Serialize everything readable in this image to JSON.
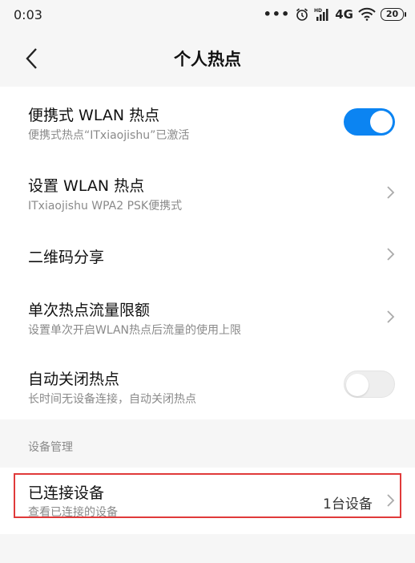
{
  "status_bar": {
    "time": "0:03",
    "more": "•••",
    "network": "4G",
    "battery": "20",
    "icons": [
      "alarm-icon",
      "hd-signal-icon",
      "wifi-icon",
      "battery-icon"
    ]
  },
  "header": {
    "title": "个人热点",
    "back_icon": "chevron-left-icon"
  },
  "settings": [
    {
      "title": "便携式 WLAN 热点",
      "subtitle": "便携式热点“ITxiaojishu”已激活",
      "control": "toggle",
      "on": true
    },
    {
      "title": "设置 WLAN 热点",
      "subtitle": "ITxiaojishu WPA2 PSK便携式",
      "control": "chevron"
    },
    {
      "title": "二维码分享",
      "control": "chevron"
    },
    {
      "title": "单次热点流量限额",
      "subtitle": "设置单次开启WLAN热点后流量的使用上限",
      "control": "chevron"
    },
    {
      "title": "自动关闭热点",
      "subtitle": "长时间无设备连接，自动关闭热点",
      "control": "toggle",
      "on": false
    }
  ],
  "device_section": {
    "header": "设备管理",
    "item": {
      "title": "已连接设备",
      "subtitle": "查看已连接的设备",
      "value": "1台设备"
    }
  },
  "colors": {
    "accent": "#0b84f2",
    "highlight": "#e03a3a",
    "background": "#f6f6f6"
  }
}
